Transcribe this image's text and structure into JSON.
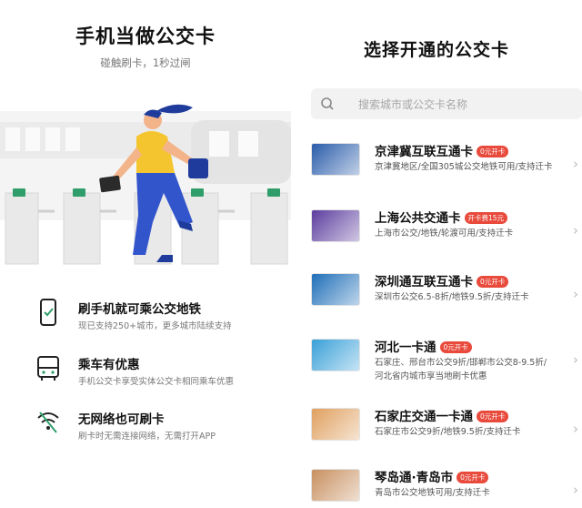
{
  "left": {
    "title": "手机当做公交卡",
    "subtitle": "碰触刷卡，1秒过闸",
    "features": [
      {
        "icon": "phone-check-icon",
        "title": "刷手机就可乘公交地铁",
        "desc": "现已支持250+城市，更多城市陆续支持"
      },
      {
        "icon": "bus-icon",
        "title": "乘车有优惠",
        "desc": "手机公交卡享受实体公交卡相同乘车优惠"
      },
      {
        "icon": "no-wifi-icon",
        "title": "无网络也可刷卡",
        "desc": "刷卡时无需连接网络，无需打开APP"
      }
    ]
  },
  "right": {
    "title": "选择开通的公交卡",
    "search_placeholder": "搜索城市或公交卡名称",
    "cards": [
      {
        "name": "京津冀互联互通卡",
        "badge": "0元开卡",
        "desc": "京津冀地区/全国305城公交地铁可用/支持迁卡",
        "card_color": "#2a5caa"
      },
      {
        "name": "上海公共交通卡",
        "badge": "开卡费15元",
        "desc": "上海市公交/地铁/轮渡可用/支持迁卡",
        "card_color": "#5c3d9e"
      },
      {
        "name": "深圳通互联互通卡",
        "badge": "0元开卡",
        "desc": "深圳市公交6.5-8折/地铁9.5折/支持迁卡",
        "card_color": "#1f6fb8"
      },
      {
        "name": "河北一卡通",
        "badge": "0元开卡",
        "desc": "石家庄、邢台市公交9折/邯郸市公交8-9.5折/河北省内城市享当地刷卡优惠",
        "card_color": "#3aa0d8"
      },
      {
        "name": "石家庄交通一卡通",
        "badge": "0元开卡",
        "desc": "石家庄市公交9折/地铁9.5折/支持迁卡",
        "card_color": "#e0a060"
      },
      {
        "name": "琴岛通·青岛市",
        "badge": "0元开卡",
        "desc": "青岛市公交地铁可用/支持迁卡",
        "card_color": "#c89060"
      }
    ]
  }
}
